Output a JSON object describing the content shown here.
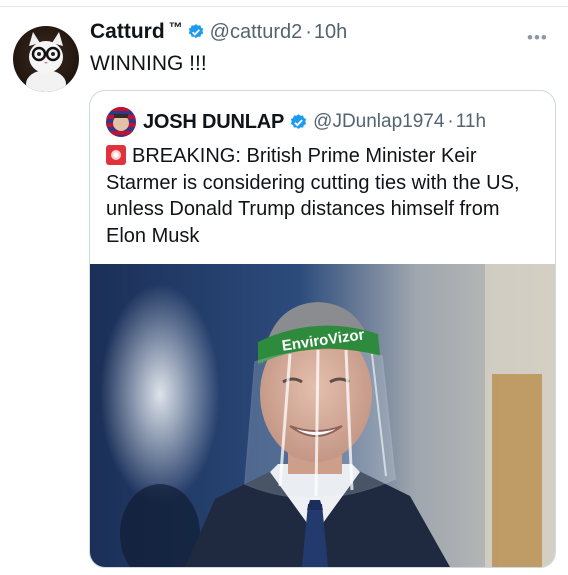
{
  "tweet": {
    "author_name": "Catturd",
    "trademark": "™",
    "handle": "@catturd2",
    "separator": "·",
    "time": "10h",
    "text": "WINNING !!!",
    "more_icon": "more-dots-icon"
  },
  "quoted_tweet": {
    "author_name": "JOSH DUNLAP",
    "handle": "@JDunlap1974",
    "separator": "·",
    "time": "11h",
    "text": "BREAKING: British Prime Minister Keir Starmer is considering cutting ties with the US,  unless Donald Trump distances himself from Elon Musk",
    "emoji": "rotating-light-icon",
    "photo_visor_text": "EnviroVizor"
  },
  "colors": {
    "verified": "#1d9bf0",
    "handle_gray": "#536471",
    "border": "#cfd9de",
    "alert_red": "#e0323c",
    "visor_green": "#2e8b3d"
  }
}
